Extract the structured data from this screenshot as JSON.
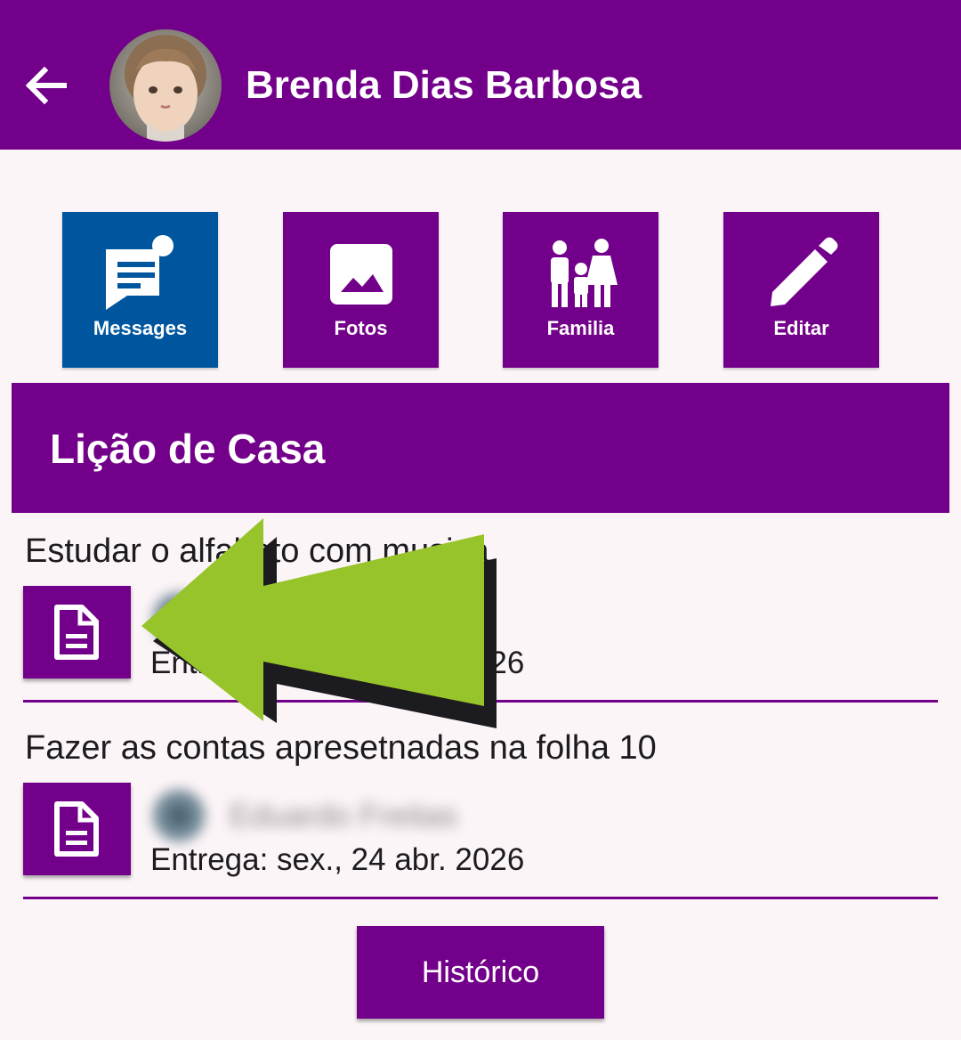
{
  "header": {
    "back_icon": "arrow-left-icon",
    "student_name": "Brenda Dias Barbosa",
    "background": "#73008a"
  },
  "actions": [
    {
      "label": "Messages",
      "icon": "message-icon",
      "active": true,
      "color": "#00569e"
    },
    {
      "label": "Fotos",
      "icon": "image-icon",
      "active": false,
      "color": "#73008a"
    },
    {
      "label": "Familia",
      "icon": "family-icon",
      "active": false,
      "color": "#73008a"
    },
    {
      "label": "Editar",
      "icon": "pencil-icon",
      "active": false,
      "color": "#73008a"
    }
  ],
  "section": {
    "title": "Lição de Casa"
  },
  "homework": [
    {
      "title": "Estudar o alfabeto com musica",
      "icon": "document-icon",
      "teacher": "Eduardo Freitas",
      "due": "Entrega: sex., 24 abr. 2026"
    },
    {
      "title": "Fazer as contas apresetnadas na folha 10",
      "icon": "document-icon",
      "teacher": "Eduardo Freitas",
      "due": "Entrega: sex., 24 abr. 2026"
    }
  ],
  "history_button": "Histórico",
  "annotation": {
    "icon": "arrow-left-icon",
    "color": "#97c42a"
  }
}
